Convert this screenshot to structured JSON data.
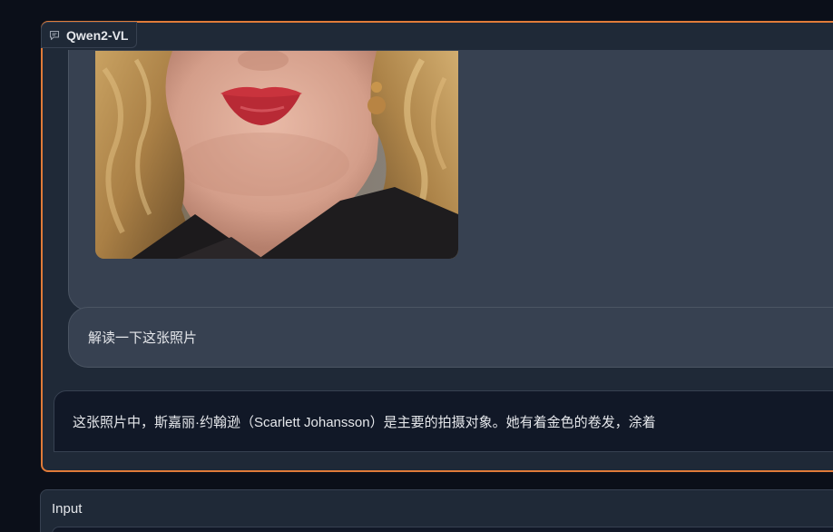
{
  "chatbot": {
    "label": "Qwen2-VL",
    "label_icon": "chat-bubble-icon",
    "messages": [
      {
        "role": "user",
        "type": "image",
        "alt": ""
      },
      {
        "role": "user",
        "type": "text",
        "text": "解读一下这张照片"
      },
      {
        "role": "assistant",
        "type": "text",
        "text": "这张照片中，斯嘉丽·约翰逊（Scarlett Johansson）是主要的拍摄对象。她有着金色的卷发，涂着"
      }
    ]
  },
  "input": {
    "label": "Input"
  },
  "colors": {
    "background": "#0b0f19",
    "panel": "#1f2937",
    "accent_border": "#e07b39",
    "user_bubble": "#374151",
    "bot_bubble": "#111827"
  }
}
